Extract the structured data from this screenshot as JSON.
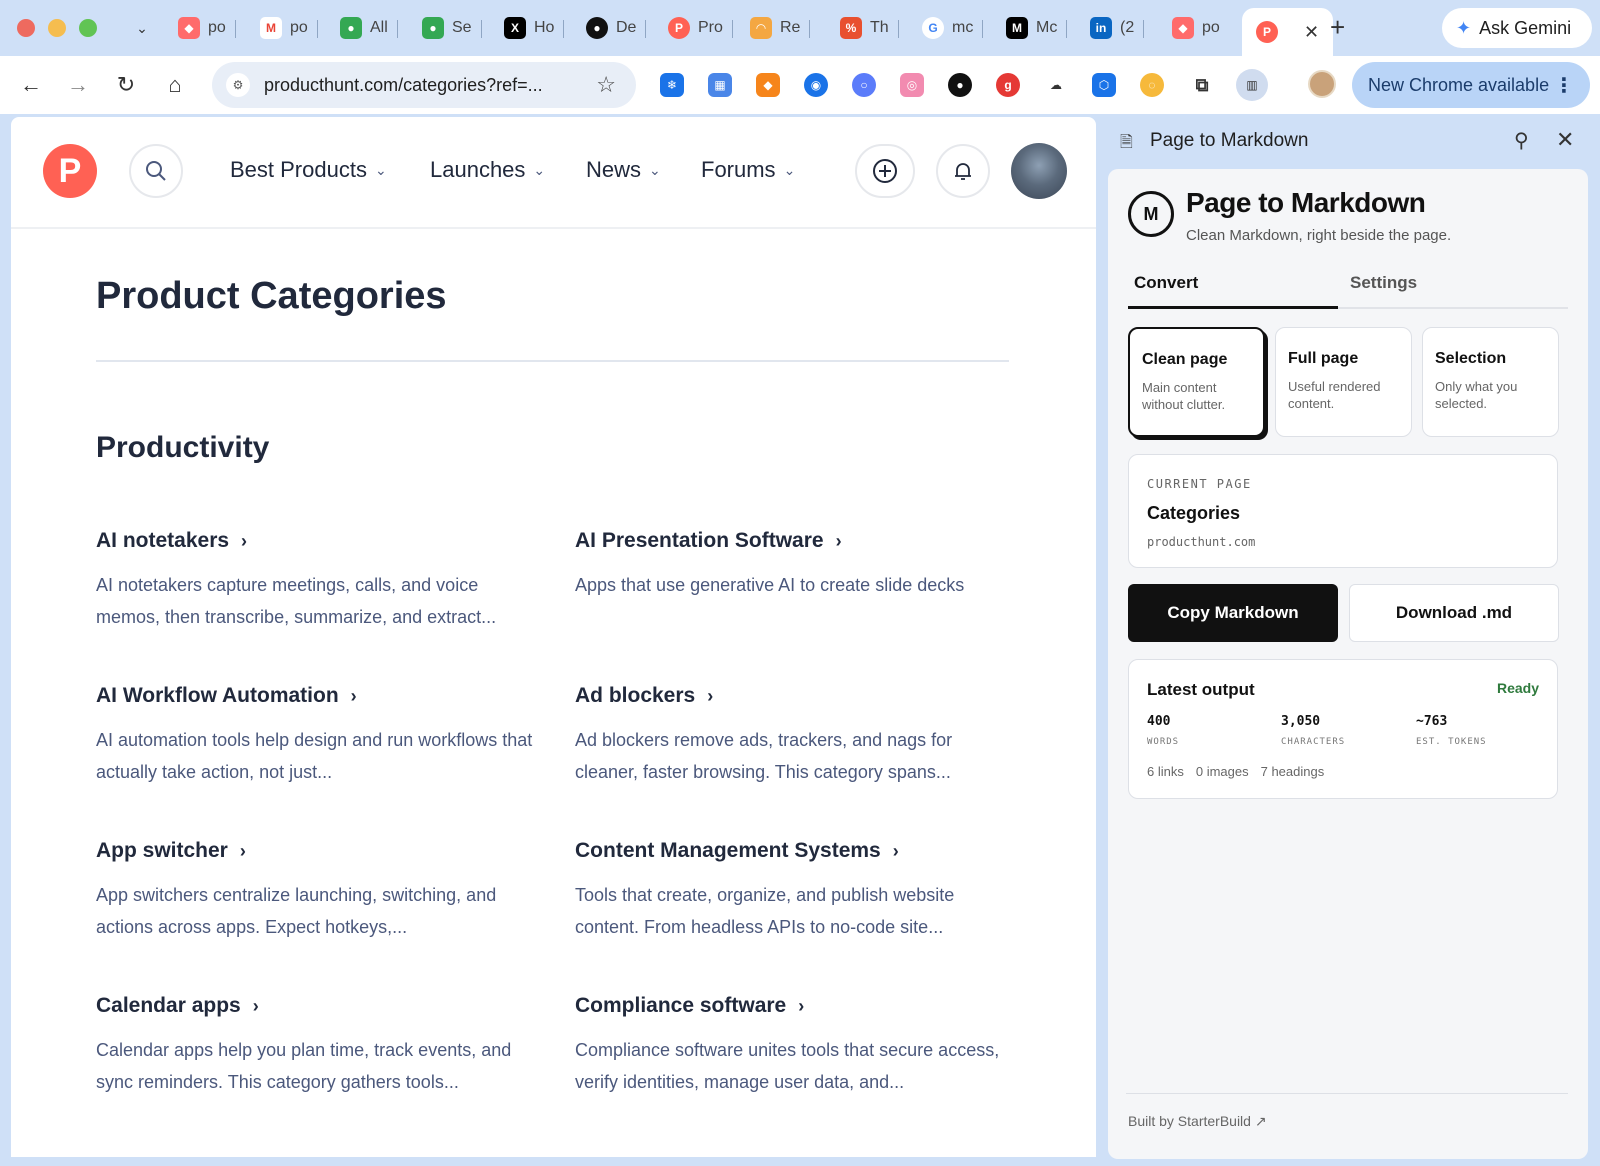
{
  "browser": {
    "tabs": [
      {
        "label": "po",
        "icon": "app-icon",
        "color": "#ff6b6b"
      },
      {
        "label": "po",
        "icon": "gmail-icon",
        "color": "#ea4335"
      },
      {
        "label": "All",
        "icon": "globe-icon",
        "color": "#34a853"
      },
      {
        "label": "Se",
        "icon": "globe-icon",
        "color": "#34a853"
      },
      {
        "label": "Ho",
        "icon": "x-icon",
        "color": "#000000"
      },
      {
        "label": "De",
        "icon": "dark-circle-icon",
        "color": "#111111"
      },
      {
        "label": "Pro",
        "icon": "producthunt-icon",
        "color": "#ff6154"
      },
      {
        "label": "Re",
        "icon": "rainbow-icon",
        "color": "#f4a742"
      },
      {
        "label": "Th",
        "icon": "percent-icon",
        "color": "#e8502f"
      },
      {
        "label": "mc",
        "icon": "google-icon",
        "color": "#4285f4"
      },
      {
        "label": "Mc",
        "icon": "medium-icon",
        "color": "#000000"
      },
      {
        "label": "(2",
        "icon": "linkedin-icon",
        "color": "#0a66c2"
      },
      {
        "label": "po",
        "icon": "app-icon",
        "color": "#ff6b6b"
      }
    ],
    "active_tab_icon": "producthunt-icon",
    "ask_gemini": "Ask Gemini",
    "url": "producthunt.com/categories?ref=...",
    "update_label": "New Chrome available"
  },
  "header": {
    "nav": [
      {
        "label": "Best Products"
      },
      {
        "label": "Launches"
      },
      {
        "label": "News"
      },
      {
        "label": "Forums"
      }
    ],
    "logo_letter": "P"
  },
  "main": {
    "title": "Product Categories",
    "section": "Productivity",
    "categories": [
      {
        "name": "AI notetakers",
        "desc": "AI notetakers capture meetings, calls, and voice memos, then transcribe, summarize, and extract..."
      },
      {
        "name": "AI Presentation Software",
        "desc": "Apps that use generative AI to create slide decks"
      },
      {
        "name": "AI Workflow Automation",
        "desc": "AI automation tools help design and run workflows that actually take action, not just..."
      },
      {
        "name": "Ad blockers",
        "desc": "Ad blockers remove ads, trackers, and nags for cleaner, faster browsing. This category spans..."
      },
      {
        "name": "App switcher",
        "desc": "App switchers centralize launching, switching, and actions across apps. Expect hotkeys,..."
      },
      {
        "name": "Content Management Systems",
        "desc": "Tools that create, organize, and publish website content. From headless APIs to no-code site..."
      },
      {
        "name": "Calendar apps",
        "desc": "Calendar apps help you plan time, track events, and sync reminders. This category gathers tools..."
      },
      {
        "name": "Compliance software",
        "desc": "Compliance software unites tools that secure access, verify identities, manage user data, and..."
      }
    ]
  },
  "side_panel": {
    "header_title": "Page to Markdown",
    "app_title": "Page to Markdown",
    "app_badge": "M",
    "subtitle": "Clean Markdown, right beside the page.",
    "tabs": {
      "convert": "Convert",
      "settings": "Settings"
    },
    "modes": [
      {
        "title": "Clean page",
        "desc": "Main content without clutter.",
        "selected": true
      },
      {
        "title": "Full page",
        "desc": "Useful rendered content.",
        "selected": false
      },
      {
        "title": "Selection",
        "desc": "Only what you selected.",
        "selected": false
      }
    ],
    "current_page": {
      "label": "CURRENT PAGE",
      "title": "Categories",
      "domain": "producthunt.com"
    },
    "copy_button": "Copy Markdown",
    "download_button": "Download .md",
    "output": {
      "title": "Latest output",
      "status": "Ready",
      "words": {
        "value": "400",
        "label": "WORDS"
      },
      "characters": {
        "value": "3,050",
        "label": "CHARACTERS"
      },
      "tokens": {
        "value": "~763",
        "label": "EST. TOKENS"
      },
      "links": "6 links",
      "images": "0 images",
      "headings": "7 headings"
    },
    "footer": "Built by StarterBuild ↗"
  }
}
